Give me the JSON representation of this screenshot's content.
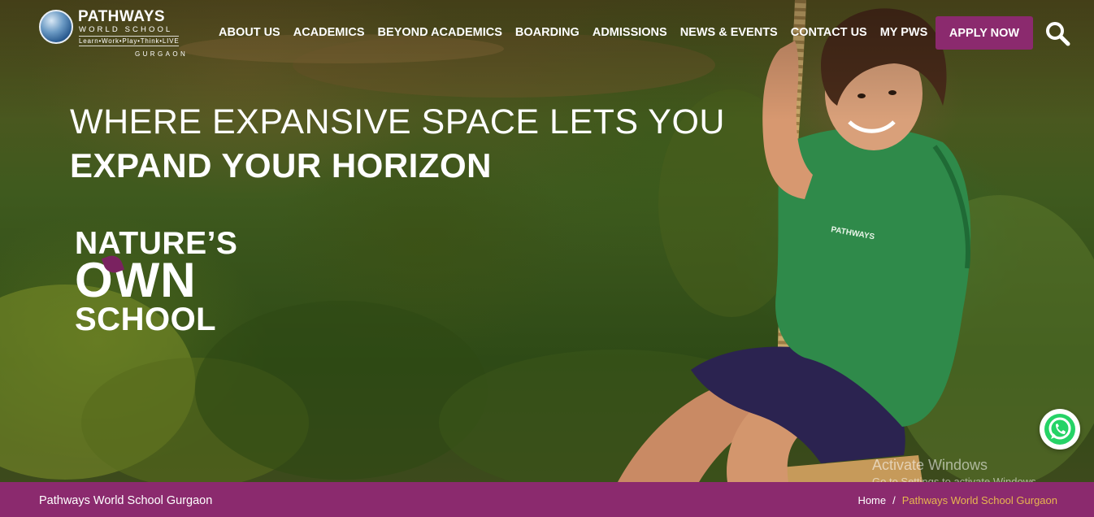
{
  "brand": {
    "name": "PATHWAYS",
    "subtitle": "WORLD SCHOOL",
    "tagline": "Learn•Work•Play•Think•LIVE",
    "city": "GURGAON"
  },
  "nav": {
    "items": [
      "ABOUT US",
      "ACADEMICS",
      "BEYOND ACADEMICS",
      "BOARDING",
      "ADMISSIONS",
      "NEWS & EVENTS",
      "CONTACT US",
      "MY PWS"
    ],
    "apply_label": "APPLY NOW"
  },
  "hero": {
    "line1": "WHERE EXPANSIVE SPACE LETS YOU",
    "line2": "EXPAND YOUR HORIZON",
    "badge_line1": "NATURE’S",
    "badge_line2": "OWN",
    "badge_line3": "SCHOOL",
    "shirt_text": "PATHWAYS"
  },
  "watermark": {
    "title": "Activate Windows",
    "subtitle": "Go to Settings to activate Windows."
  },
  "footer": {
    "title": "Pathways World School Gurgaon",
    "breadcrumb_home": "Home",
    "breadcrumb_sep": "/",
    "breadcrumb_current": "Pathways World School Gurgaon"
  },
  "colors": {
    "brand_purple": "#8b2a6e",
    "breadcrumb_accent": "#e7b64f"
  },
  "icons": [
    "search-icon",
    "whatsapp-icon",
    "globe-logo-icon"
  ]
}
